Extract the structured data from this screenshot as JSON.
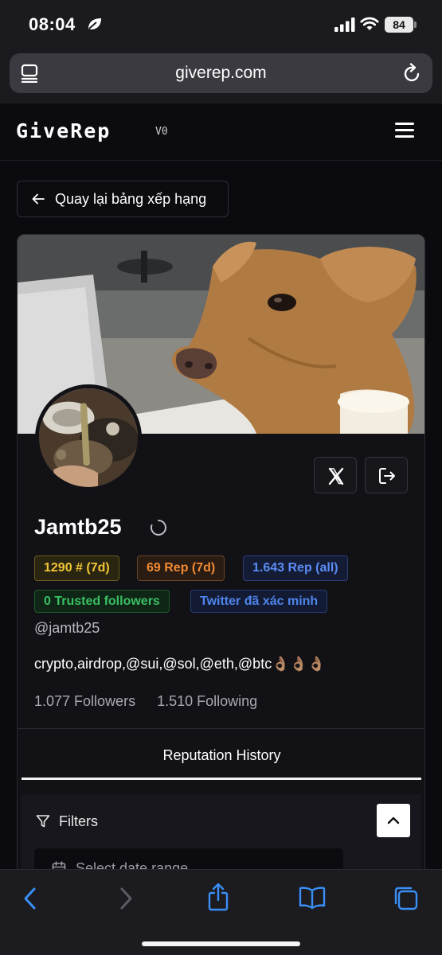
{
  "status_bar": {
    "time": "08:04",
    "battery": "84"
  },
  "browser": {
    "url": "giverep.com"
  },
  "header": {
    "logo": "GiveRep",
    "version": "V0"
  },
  "back_button": {
    "label": "Quay lại bảng xếp hạng"
  },
  "profile": {
    "name": "Jamtb25",
    "handle": "@jamtb25",
    "bio": "crypto,airdrop,@sui,@sol,@eth,@btc👌🏽👌🏽👌🏽",
    "followers": "1.077 Followers",
    "following": "1.510 Following",
    "badges": {
      "rank": "1290 # (7d)",
      "rep_7d": "69 Rep (7d)",
      "rep_all": "1.643 Rep (all)",
      "trusted": "0 Trusted followers",
      "twitter": "Twitter đã xác minh"
    }
  },
  "tabs": {
    "reputation_history": "Reputation History"
  },
  "filters": {
    "label": "Filters",
    "date_placeholder": "Select date range"
  },
  "colors": {
    "rank": "#f2c536",
    "rep_7d": "#f08a34",
    "rep_all": "#5b8cf3",
    "trusted": "#3bbf63",
    "twitter": "#4f85ec",
    "accent_ios": "#3a8ff7"
  },
  "icons": [
    "moon-leaf-icon",
    "signal-icon",
    "wifi-icon",
    "tabs-icon",
    "reload-icon",
    "menu-icon",
    "arrow-left-icon",
    "x-logo-icon",
    "logout-icon",
    "spinner-icon",
    "filter-icon",
    "chevron-up-icon",
    "calendar-icon",
    "back-icon",
    "forward-icon",
    "share-icon",
    "bookmarks-icon",
    "tabs-overview-icon"
  ]
}
